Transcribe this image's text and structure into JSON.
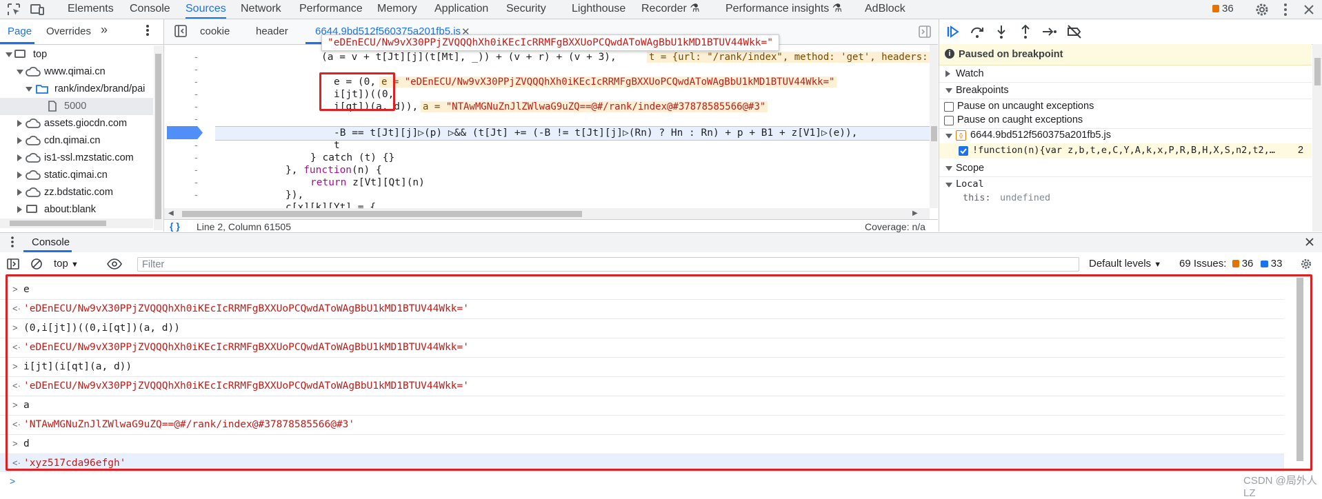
{
  "main_tabs": [
    "Elements",
    "Console",
    "Sources",
    "Network",
    "Performance",
    "Memory",
    "Application",
    "Security",
    "Lighthouse",
    "Recorder",
    "Performance insights",
    "AdBlock"
  ],
  "issues_count": "36",
  "navigator": {
    "tabs": [
      "Page",
      "Overrides"
    ],
    "tree": [
      "top",
      "www.qimai.cn",
      "rank/index/brand/pai",
      "5000",
      "assets.giocdn.com",
      "cdn.qimai.cn",
      "is1-ssl.mzstatic.com",
      "static.qimai.cn",
      "zz.bdstatic.com",
      "about:blank"
    ]
  },
  "editor": {
    "tabs": [
      "cookie",
      "header",
      "6644.9bd512f560375a201fb5.js"
    ],
    "tooltip": "\"eDEnECU/Nw9vX30PPjZVQQQhXh0iKEcIcRRMFgBXXUoPCQwdAToWAgBbU1kMD1BTUV44Wkk=\"",
    "line1_inline": "t = {url: \"/rank/index\", method: 'get', headers:",
    "line2_code": "e = (0,",
    "line2_inline_key": "e = ",
    "line2_inline_val": "\"eDEnECU/Nw9vX30PPjZVQQQhXh0iKEcIcRRMFgBXXUoPCQwdAToWAgBbU1kMD1BTUV44Wkk=\"",
    "line3_code": "i[jt])((0,",
    "line4_code": "i[qt])(a, d)),",
    "line4_inline_key": "a = ",
    "line4_inline_val": "\"NTAwMGNuZnJlZWlwaG9uZQ==@#/rank/index@#37878585566@#3\"",
    "line5_code": "-B == t[Jt][j]▷(p) ▷&& (t[Jt] += (-B != t[Jt][j]▷(Rn) ? Hn : Rn) + p + B1 + z[V1]▷(e)),",
    "line6_code": "t",
    "line7_code": "} catch (t) {}",
    "line8_code_a": "}, ",
    "line8_kw": "function",
    "line8_code_b": "(n) {",
    "line9_kw": "return",
    "line9_code": " z[Vt][Qt](n)",
    "line10_code": "}),",
    "line11_code": "c[x][k][Yt] = {",
    "line0_code": "(a = v + t[Jt][j](t[Mt], _)) + (v + r) + (v + 3),",
    "status_position": "Line 2, Column 61505",
    "status_coverage": "Coverage: n/a"
  },
  "debugger": {
    "paused": "Paused on breakpoint",
    "watch": "Watch",
    "breakpoints": "Breakpoints",
    "pause_uncaught": "Pause on uncaught exceptions",
    "pause_caught": "Pause on caught exceptions",
    "bp_file": "6644.9bd512f560375a201fb5.js",
    "bp_code": "!function(n){var z,b,t,e,C,Y,A,k,x,P,R,B,H,X,S,n2,t2,…",
    "bp_line": "2",
    "scope": "Scope",
    "local": "Local",
    "this_key": "this:",
    "this_val": "undefined"
  },
  "drawer": {
    "tab": "Console",
    "context": "top",
    "filter_placeholder": "Filter",
    "levels": "Default levels",
    "issues_label": "69 Issues:",
    "issues_warn": "36",
    "issues_info": "33"
  },
  "console_lines": [
    {
      "kind": "input",
      "text": "e"
    },
    {
      "kind": "result",
      "text": "'eDEnECU/Nw9vX30PPjZVQQQhXh0iKEcIcRRMFgBXXUoPCQwdAToWAgBbU1kMD1BTUV44Wkk='"
    },
    {
      "kind": "input",
      "text": "(0,i[jt])((0,i[qt])(a, d))"
    },
    {
      "kind": "result",
      "text": "'eDEnECU/Nw9vX30PPjZVQQQhXh0iKEcIcRRMFgBXXUoPCQwdAToWAgBbU1kMD1BTUV44Wkk='"
    },
    {
      "kind": "input",
      "text": "i[jt](i[qt](a, d))"
    },
    {
      "kind": "result",
      "text": "'eDEnECU/Nw9vX30PPjZVQQQhXh0iKEcIcRRMFgBXXUoPCQwdAToWAgBbU1kMD1BTUV44Wkk='"
    },
    {
      "kind": "input",
      "text": "a"
    },
    {
      "kind": "result",
      "text": "'NTAwMGNuZnJlZWlwaG9uZQ==@#/rank/index@#37878585566@#3'"
    },
    {
      "kind": "input",
      "text": "d"
    },
    {
      "kind": "result",
      "text": "'xyz517cda96efgh'"
    }
  ],
  "watermark": "CSDN @局外人LZ",
  "colors": {
    "accent": "#1a73e8",
    "string": "#c41a16",
    "highlight_box": "#e02020",
    "warning": "#e37400"
  }
}
